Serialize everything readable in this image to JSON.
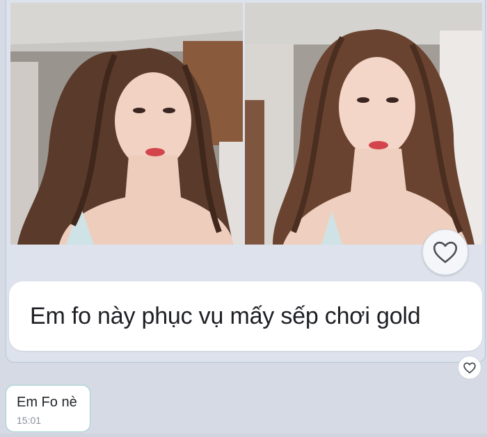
{
  "chat": {
    "photo_message": {
      "images": [
        {
          "icon": "photo-left"
        },
        {
          "icon": "photo-right"
        }
      ],
      "caption": "Em fo này phục vụ mấy sếp chơi gold",
      "reaction_icon": "heart-outline-icon"
    },
    "text_message": {
      "text": "Em Fo nè",
      "time": "15:01"
    }
  },
  "colors": {
    "background": "#d5dae5",
    "bubble_border": "#9fcfd0",
    "caption_text": "#1d1f24",
    "timestamp": "#8a8f98"
  }
}
